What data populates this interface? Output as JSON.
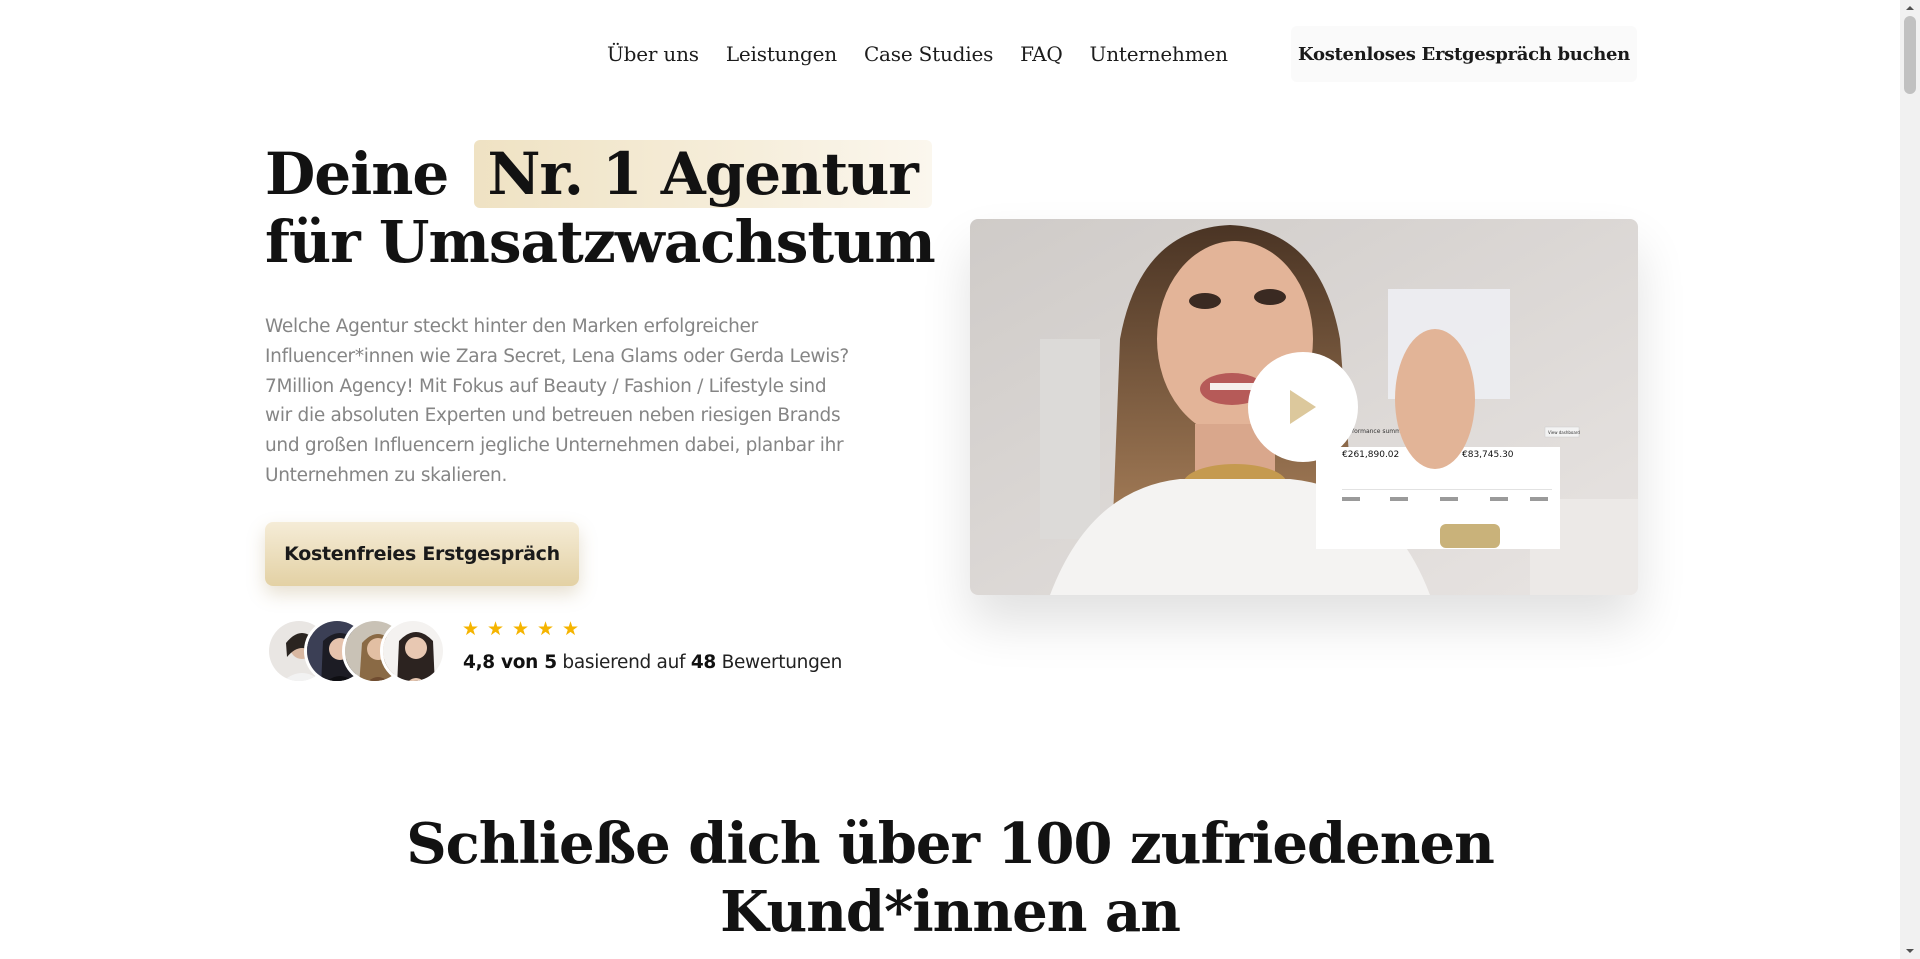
{
  "nav": {
    "links": [
      "Über uns",
      "Leistungen",
      "Case Studies",
      "FAQ",
      "Unternehmen"
    ],
    "cta_label": "Kostenloses Erstgespräch buchen"
  },
  "hero": {
    "title_before": "Deine",
    "title_highlight": "Nr. 1 Agentur",
    "title_after": "für Umsatzwachstum",
    "description": "Welche Agentur steckt hinter den Marken erfolgreicher Influencer*innen wie Zara Secret, Lena Glams oder Gerda Lewis? 7Million Agency! Mit Fokus auf Beauty / Fashion / Lifestyle sind wir die absoluten Experten und betreuen neben riesigen Brands und großen Influencern jegliche Unternehmen dabei, planbar ihr Unternehmen zu skalieren.",
    "button_label": "Kostenfreies Erstgespräch",
    "rating": {
      "stars": 5,
      "score": "4,8 von 5",
      "middle": "basierend auf",
      "count": "48",
      "suffix": "Bewertungen"
    }
  },
  "video": {
    "dashboard_title": "performance summary",
    "metric_1": "€261,890.02",
    "metric_2": "€83,745.30",
    "dashboard_button": "View dashboard"
  },
  "section": {
    "title_line1": "Schließe dich über 100 zufriedenen",
    "title_line2": "Kund*innen an"
  },
  "colors": {
    "highlight": "#efe2c3",
    "button_gold": "#e3d1a4",
    "star": "#f5b400",
    "body_text": "#858585"
  }
}
